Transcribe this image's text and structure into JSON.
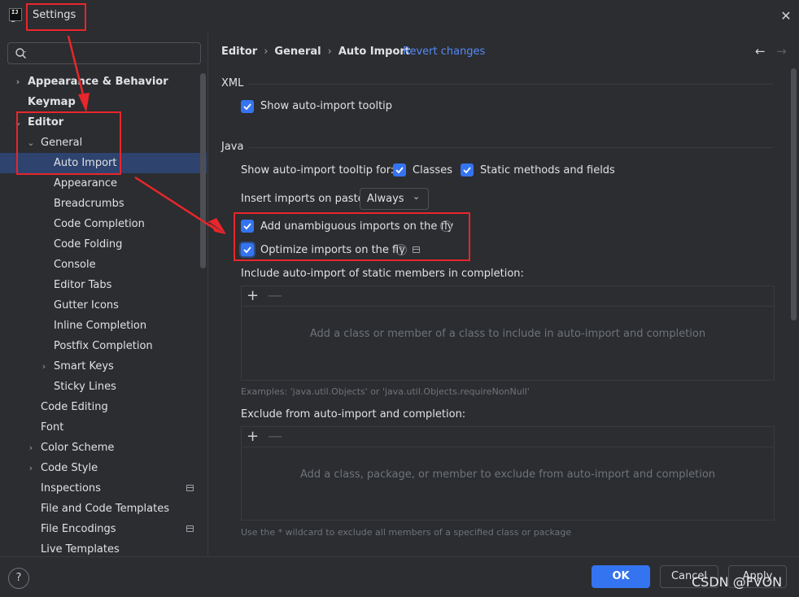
{
  "window": {
    "title": "Settings",
    "close": "✕"
  },
  "sidebar": {
    "search_placeholder": "",
    "items": [
      {
        "label": "Appearance & Behavior",
        "level": 0,
        "bold": true,
        "expandable": true,
        "expanded": false
      },
      {
        "label": "Keymap",
        "level": 0,
        "bold": true,
        "expandable": false
      },
      {
        "label": "Editor",
        "level": 0,
        "bold": true,
        "expandable": true,
        "expanded": true
      },
      {
        "label": "General",
        "level": 1,
        "expandable": true,
        "expanded": true
      },
      {
        "label": "Auto Import",
        "level": 2,
        "selected": true
      },
      {
        "label": "Appearance",
        "level": 2
      },
      {
        "label": "Breadcrumbs",
        "level": 2
      },
      {
        "label": "Code Completion",
        "level": 2
      },
      {
        "label": "Code Folding",
        "level": 2
      },
      {
        "label": "Console",
        "level": 2
      },
      {
        "label": "Editor Tabs",
        "level": 2
      },
      {
        "label": "Gutter Icons",
        "level": 2
      },
      {
        "label": "Inline Completion",
        "level": 2
      },
      {
        "label": "Postfix Completion",
        "level": 2
      },
      {
        "label": "Smart Keys",
        "level": 2,
        "expandable": true,
        "expanded": false
      },
      {
        "label": "Sticky Lines",
        "level": 2
      },
      {
        "label": "Code Editing",
        "level": 1
      },
      {
        "label": "Font",
        "level": 1
      },
      {
        "label": "Color Scheme",
        "level": 1,
        "expandable": true,
        "expanded": false
      },
      {
        "label": "Code Style",
        "level": 1,
        "expandable": true,
        "expanded": false
      },
      {
        "label": "Inspections",
        "level": 1,
        "badge": true
      },
      {
        "label": "File and Code Templates",
        "level": 1
      },
      {
        "label": "File Encodings",
        "level": 1,
        "badge": true
      },
      {
        "label": "Live Templates",
        "level": 1
      }
    ]
  },
  "breadcrumb": {
    "items": [
      "Editor",
      "General",
      "Auto Import"
    ],
    "separator": "›",
    "revert": "Revert changes"
  },
  "nav": {
    "back": "←",
    "forward": "→"
  },
  "xml": {
    "title": "XML",
    "show_tooltip": {
      "label": "Show auto-import tooltip",
      "checked": true
    }
  },
  "java": {
    "title": "Java",
    "tooltip_for_label": "Show auto-import tooltip for:",
    "classes": {
      "label": "Classes",
      "checked": true
    },
    "static_methods": {
      "label": "Static methods and fields",
      "checked": true
    },
    "insert_on_paste_label": "Insert imports on paste:",
    "insert_on_paste_value": "Always",
    "add_unambiguous": {
      "label": "Add unambiguous imports on the fly",
      "checked": true
    },
    "optimize": {
      "label": "Optimize imports on the fly",
      "checked": true
    },
    "include_label": "Include auto-import of static members in completion:",
    "include_empty": "Add a class or member of a class to include in auto-import and completion",
    "include_hint": "Examples: 'java.util.Objects' or 'java.util.Objects.requireNonNull'",
    "exclude_label": "Exclude from auto-import and completion:",
    "exclude_empty": "Add a class, package, or member to exclude from auto-import and completion",
    "exclude_hint": "Use the * wildcard to exclude all members of a specified class or package"
  },
  "toolbar": {
    "add": "+",
    "remove": "—"
  },
  "footer": {
    "help": "?",
    "ok": "OK",
    "cancel": "Cancel",
    "apply": "Apply"
  },
  "watermark": "CSDN @FVON",
  "colors": {
    "accent": "#3574f0",
    "annotation": "#e8262b",
    "selection": "#2e436e",
    "link": "#548af7"
  }
}
